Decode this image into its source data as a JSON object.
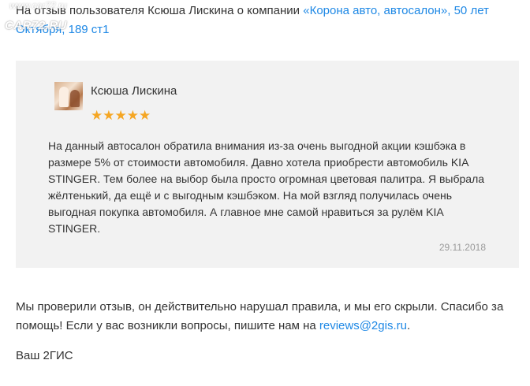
{
  "intro": {
    "prefix": "На отзыв пользователя Ксюша Лискина о компании ",
    "company_link": "«Корона авто, автосалон», 50 лет Октября, 189 ст1"
  },
  "watermark": {
    "top": "www.car72.ru",
    "main": "CAR72.RU"
  },
  "review": {
    "author": "Ксюша Лискина",
    "rating": 5,
    "stars": "★★★★★",
    "text": "На данный автосалон обратила внимания из-за очень выгодной акции кэшбэка в размере 5% от стоимости автомобиля. Давно хотела приобрести автомобиль KIA STINGER. Тем более на выбор была просто огромная цветовая палитра. Я выбрала жёлтенький, да ещё и с выгодным кэшбэком. На мой взгляд получилась очень выгодная покупка автомобиля. А главное мне самой нравиться за рулём KIA STINGER.",
    "date": "29.11.2018"
  },
  "answer": {
    "text": "Мы проверили отзыв, он действительно нарушал правила, и мы его скрыли. Спасибо за помощь! Если у вас возникли вопросы, пишите нам на ",
    "email": "reviews@2gis.ru",
    "suffix": "."
  },
  "signature": "Ваш 2ГИС",
  "colors": {
    "link": "#1e88e5",
    "star": "#f5a623",
    "card_background": "#f2f2f2",
    "date": "#9a9a9a"
  }
}
